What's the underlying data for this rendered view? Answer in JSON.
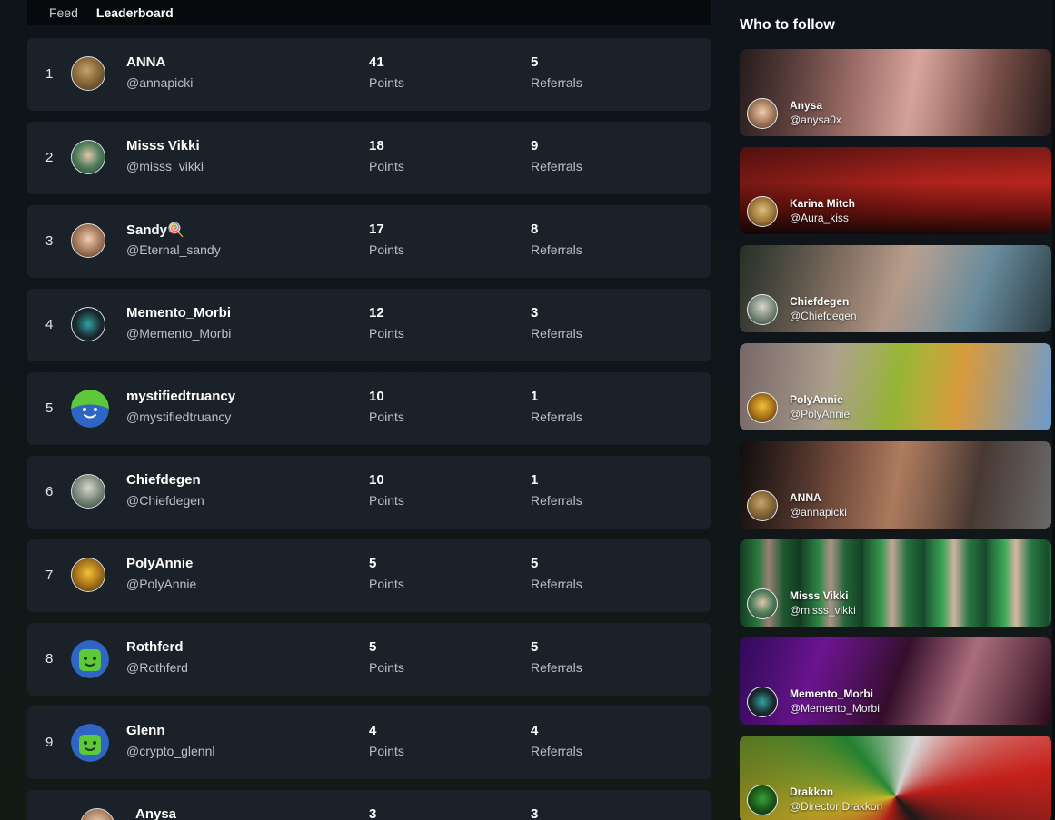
{
  "tabs": {
    "feed": "Feed",
    "leaderboard": "Leaderboard"
  },
  "sidebar": {
    "title": "Who to follow"
  },
  "leaderboard": {
    "rows": [
      {
        "rank": "1",
        "name": "ANNA",
        "handle": "@annapicki",
        "points": "41",
        "points_label": "Points",
        "referrals": "5",
        "referrals_label": "Referrals"
      },
      {
        "rank": "2",
        "name": "Misss Vikki",
        "handle": "@misss_vikki",
        "points": "18",
        "points_label": "Points",
        "referrals": "9",
        "referrals_label": "Referrals"
      },
      {
        "rank": "3",
        "name": "Sandy🍭",
        "handle": "@Eternal_sandy",
        "points": "17",
        "points_label": "Points",
        "referrals": "8",
        "referrals_label": "Referrals"
      },
      {
        "rank": "4",
        "name": "Memento_Morbi",
        "handle": "@Memento_Morbi",
        "points": "12",
        "points_label": "Points",
        "referrals": "3",
        "referrals_label": "Referrals"
      },
      {
        "rank": "5",
        "name": "mystifiedtruancy",
        "handle": "@mystifiedtruancy",
        "points": "10",
        "points_label": "Points",
        "referrals": "1",
        "referrals_label": "Referrals"
      },
      {
        "rank": "6",
        "name": "Chiefdegen",
        "handle": "@Chiefdegen",
        "points": "10",
        "points_label": "Points",
        "referrals": "1",
        "referrals_label": "Referrals"
      },
      {
        "rank": "7",
        "name": "PolyAnnie",
        "handle": "@PolyAnnie",
        "points": "5",
        "points_label": "Points",
        "referrals": "5",
        "referrals_label": "Referrals"
      },
      {
        "rank": "8",
        "name": "Rothferd",
        "handle": "@Rothferd",
        "points": "5",
        "points_label": "Points",
        "referrals": "5",
        "referrals_label": "Referrals"
      },
      {
        "rank": "9",
        "name": "Glenn",
        "handle": "@crypto_glennl",
        "points": "4",
        "points_label": "Points",
        "referrals": "4",
        "referrals_label": "Referrals"
      },
      {
        "rank": "",
        "name": "Anysa",
        "handle": "",
        "points": "3",
        "points_label": "",
        "referrals": "3",
        "referrals_label": ""
      }
    ]
  },
  "follow_cards": [
    {
      "name": "Anysa",
      "handle": "@anysa0x"
    },
    {
      "name": "Karina Mitch",
      "handle": "@Aura_kiss"
    },
    {
      "name": "Chiefdegen",
      "handle": "@Chiefdegen"
    },
    {
      "name": "PolyAnnie",
      "handle": "@PolyAnnie"
    },
    {
      "name": "ANNA",
      "handle": "@annapicki"
    },
    {
      "name": "Misss Vikki",
      "handle": "@misss_vikki"
    },
    {
      "name": "Memento_Morbi",
      "handle": "@Memento_Morbi"
    },
    {
      "name": "Drakkon",
      "handle": "@Director Drakkon"
    }
  ],
  "colors": {
    "row_bg": "#1b2128",
    "tabbar_bg": "#070a0d",
    "text_muted": "#b9c0c7"
  }
}
